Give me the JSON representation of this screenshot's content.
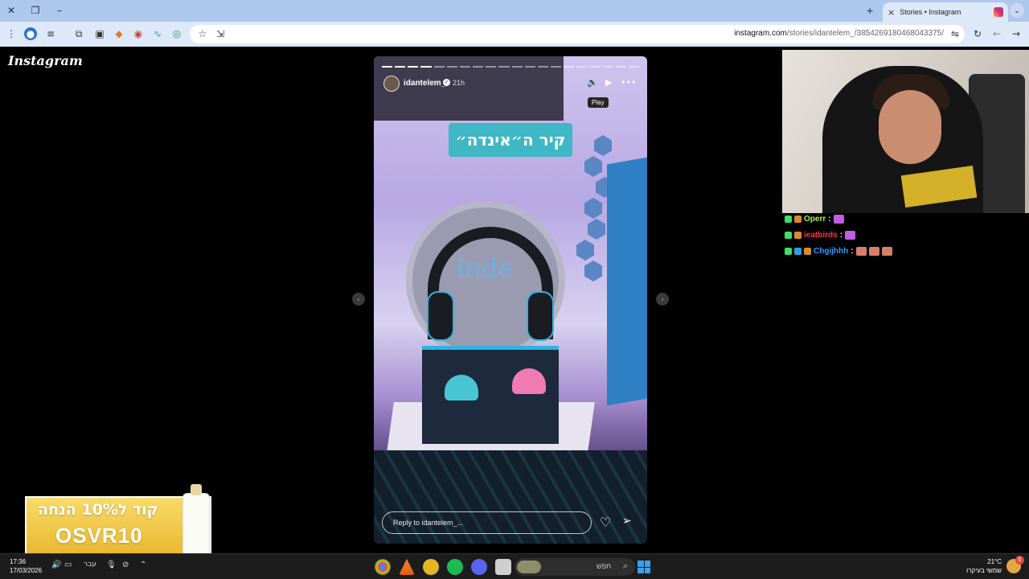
{
  "browser": {
    "tab_title": "Stories • Instagram",
    "tab_close": "×",
    "new_tab": "+",
    "tab_menu": "⌄",
    "url_main": "instagram.com",
    "url_path": "/stories/idantelem_/3854269180468043375/"
  },
  "page": {
    "logo": "Instagram",
    "story": {
      "username": "idantelem_",
      "time": "21h",
      "tooltip": "Play",
      "sign_text": "קיר ה״אינדה״",
      "disc_text": "Inde",
      "reply_placeholder": "Reply to idantelem_...",
      "progress_total": 20,
      "progress_done": 4
    },
    "chat": [
      {
        "user": "Operr",
        "user_color": "#a6f24a",
        "message": ":"
      },
      {
        "user": "ieatbirds",
        "user_color": "#ff3344",
        "message": ":"
      },
      {
        "user": "Chgijhhh",
        "user_color": "#2f9bff",
        "message": ":"
      }
    ],
    "ad": {
      "line1": "קוד ל10% הנחה",
      "line2": "OSVR10"
    }
  },
  "taskbar": {
    "time": "17:36",
    "date": "17/03/2026",
    "language": "עבר",
    "search_placeholder": "חפש",
    "temperature": "21°C",
    "weather_desc": "שמשי בעיקרו",
    "notification_count": "5"
  }
}
